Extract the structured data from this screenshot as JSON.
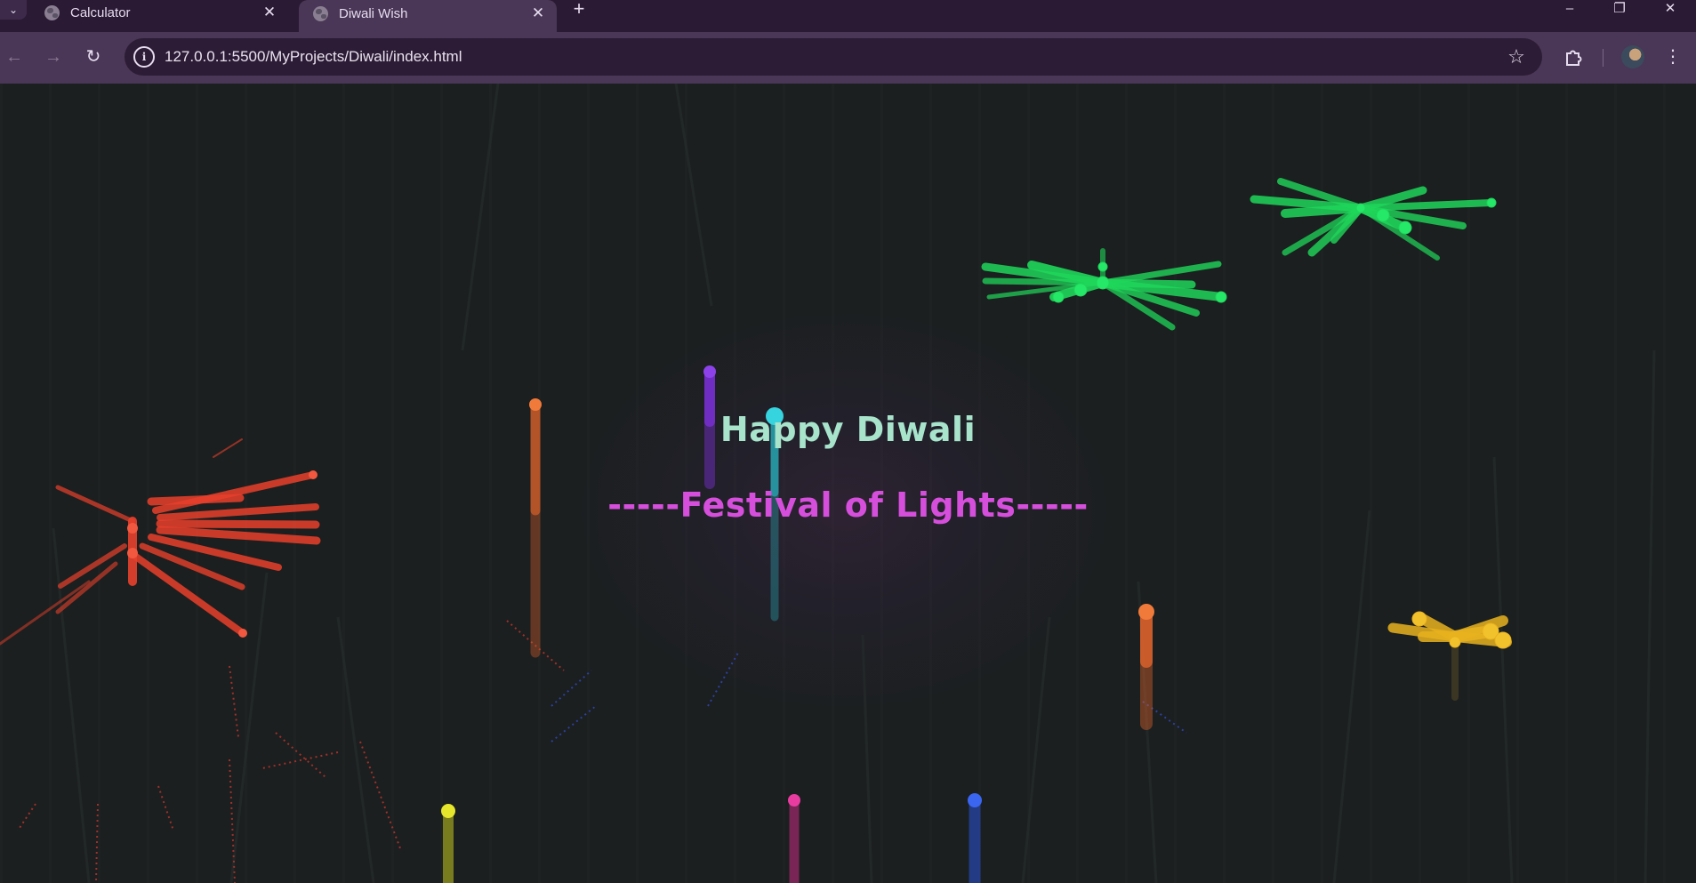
{
  "browser": {
    "tabs": [
      {
        "title": "Calculator",
        "active": false
      },
      {
        "title": "Diwali Wish",
        "active": true
      }
    ],
    "url": "127.0.0.1:5500/MyProjects/Diwali/index.html",
    "icons": {
      "tab_search": "chevron-down-icon",
      "close_tab": "close-icon",
      "new_tab": "plus-icon",
      "back": "arrow-left-icon",
      "forward": "arrow-right-icon",
      "reload": "reload-icon",
      "site_info": "info-icon",
      "bookmark": "star-icon",
      "extensions": "puzzle-icon",
      "menu": "more-vertical-icon"
    },
    "window_controls": [
      "minimize",
      "restore",
      "close"
    ]
  },
  "page": {
    "greeting": "Happy Diwali",
    "subtitle": "-----Festival of Lights-----",
    "colors": {
      "background": "#1b1f1f",
      "greeting": "#a8e3cc",
      "subtitle": "#d64fdc",
      "firework_red": "#e8402c",
      "firework_green": "#1fd65a",
      "firework_yellow": "#e8b21f",
      "rocket_orange": "#e8662c",
      "rocket_purple": "#7b2fd6",
      "rocket_cyan": "#28c6d2",
      "rocket_yellow": "#d6d61f",
      "rocket_pink": "#d62c8c",
      "rocket_blue": "#2c56e8"
    }
  }
}
